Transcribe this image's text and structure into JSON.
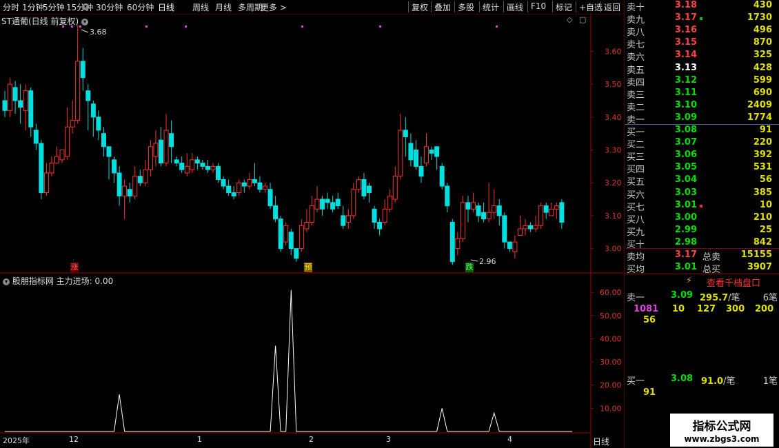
{
  "toolbar": {
    "periods": [
      "分时",
      "1分钟",
      "5分钟",
      "15分钟",
      "30分钟",
      "60分钟",
      "日线",
      "周线",
      "月线",
      "多周期",
      "更多 >"
    ],
    "active_period": "日线",
    "actions": [
      "复权",
      "叠加",
      "多股",
      "统计",
      "画线",
      "F10",
      "标记",
      "+自选",
      "返回"
    ]
  },
  "chart_header": {
    "title": "ST通葡(日线 前复权)",
    "high_label": "3.68",
    "low_label": "2.96"
  },
  "price_axis": {
    "ticks": [
      "3.60",
      "3.50",
      "3.40",
      "3.30",
      "3.20",
      "3.10",
      "3.00"
    ]
  },
  "indicator": {
    "name": "股朋指标网",
    "label": "主力进场: 0.00",
    "ticks": [
      "60.00",
      "50.00",
      "40.00",
      "30.00",
      "20.00",
      "10.00"
    ]
  },
  "badges": {
    "rise": "涨",
    "warn": "预",
    "fall": "跌"
  },
  "date_axis": {
    "labels": [
      "2025年",
      "12",
      "1",
      "2",
      "3",
      "4"
    ],
    "period": "日线"
  },
  "order_book": {
    "asks": [
      {
        "label": "卖十",
        "price": "3.18",
        "vol": "430",
        "color": "red"
      },
      {
        "label": "卖九",
        "price": "3.17",
        "vol": "1730",
        "color": "red",
        "mark": "green"
      },
      {
        "label": "卖八",
        "price": "3.16",
        "vol": "496",
        "color": "red"
      },
      {
        "label": "卖七",
        "price": "3.15",
        "vol": "870",
        "color": "red"
      },
      {
        "label": "卖六",
        "price": "3.14",
        "vol": "325",
        "color": "red"
      },
      {
        "label": "卖五",
        "price": "3.13",
        "vol": "428",
        "color": "white"
      },
      {
        "label": "卖四",
        "price": "3.12",
        "vol": "599",
        "color": "green"
      },
      {
        "label": "卖三",
        "price": "3.11",
        "vol": "690",
        "color": "green"
      },
      {
        "label": "卖二",
        "price": "3.10",
        "vol": "2409",
        "color": "green"
      },
      {
        "label": "卖一",
        "price": "3.09",
        "vol": "1774",
        "color": "green"
      }
    ],
    "bids": [
      {
        "label": "买一",
        "price": "3.08",
        "vol": "91",
        "color": "green"
      },
      {
        "label": "买二",
        "price": "3.07",
        "vol": "220",
        "color": "green"
      },
      {
        "label": "买三",
        "price": "3.06",
        "vol": "392",
        "color": "green"
      },
      {
        "label": "买四",
        "price": "3.05",
        "vol": "531",
        "color": "green"
      },
      {
        "label": "买五",
        "price": "3.04",
        "vol": "56",
        "color": "green"
      },
      {
        "label": "买六",
        "price": "3.03",
        "vol": "385",
        "color": "green"
      },
      {
        "label": "买七",
        "price": "3.01",
        "vol": "10",
        "color": "green",
        "mark": "red"
      },
      {
        "label": "买八",
        "price": "3.00",
        "vol": "210",
        "color": "green"
      },
      {
        "label": "买九",
        "price": "2.99",
        "vol": "25",
        "color": "green"
      },
      {
        "label": "买十",
        "price": "2.98",
        "vol": "842",
        "color": "green"
      }
    ],
    "avg_sell": {
      "label": "卖均",
      "price": "3.17",
      "total_label": "总卖",
      "total": "15155"
    },
    "avg_buy": {
      "label": "买均",
      "price": "3.01",
      "total_label": "总买",
      "total": "3907"
    }
  },
  "depth": {
    "button": "查看千档盘口",
    "sell1": {
      "label": "卖一",
      "price": "3.09",
      "avg": "295.7",
      "unit": "/笔",
      "count": "6笔"
    },
    "sell1_orders": [
      "1081",
      "10",
      "127",
      "300",
      "200"
    ],
    "sell1_orders2": [
      "56"
    ],
    "buy1": {
      "label": "买一",
      "price": "3.08",
      "avg": "91.0",
      "unit": "/笔",
      "count": "1笔"
    },
    "buy1_orders": [
      "91"
    ]
  },
  "watermark": {
    "line1": "指标公式网",
    "line2": "www.zbgs3.com"
  },
  "chart_data": {
    "type": "candlestick",
    "y_range": [
      2.93,
      3.71
    ],
    "indicator_range": [
      0,
      66
    ],
    "candles": [
      [
        3.45,
        3.42,
        3.48,
        3.4
      ],
      [
        3.42,
        3.5,
        3.52,
        3.4
      ],
      [
        3.49,
        3.45,
        3.51,
        3.41
      ],
      [
        3.45,
        3.43,
        3.5,
        3.38
      ],
      [
        3.42,
        3.48,
        3.5,
        3.36
      ],
      [
        3.48,
        3.37,
        3.49,
        3.34
      ],
      [
        3.36,
        3.32,
        3.38,
        3.3
      ],
      [
        3.32,
        3.17,
        3.33,
        3.15
      ],
      [
        3.17,
        3.23,
        3.26,
        3.16
      ],
      [
        3.23,
        3.26,
        3.28,
        3.22
      ],
      [
        3.26,
        3.28,
        3.31,
        3.26
      ],
      [
        3.27,
        3.3,
        3.3,
        3.26
      ],
      [
        3.28,
        3.37,
        3.43,
        3.27
      ],
      [
        3.37,
        3.39,
        3.45,
        3.35
      ],
      [
        3.39,
        3.57,
        3.68,
        3.38
      ],
      [
        3.57,
        3.52,
        3.61,
        3.48
      ],
      [
        3.48,
        3.45,
        3.5,
        3.36
      ],
      [
        3.44,
        3.4,
        3.45,
        3.34
      ],
      [
        3.4,
        3.36,
        3.42,
        3.33
      ],
      [
        3.35,
        3.31,
        3.37,
        3.28
      ],
      [
        3.31,
        3.28,
        3.31,
        3.21
      ],
      [
        3.27,
        3.23,
        3.28,
        3.2
      ],
      [
        3.23,
        3.16,
        3.25,
        3.13
      ],
      [
        3.16,
        3.19,
        3.21,
        3.09
      ],
      [
        3.18,
        3.16,
        3.2,
        3.14
      ],
      [
        3.16,
        3.22,
        3.25,
        3.15
      ],
      [
        3.22,
        3.2,
        3.24,
        3.19
      ],
      [
        3.2,
        3.24,
        3.27,
        3.19
      ],
      [
        3.24,
        3.31,
        3.33,
        3.22
      ],
      [
        3.28,
        3.32,
        3.36,
        3.25
      ],
      [
        3.33,
        3.26,
        3.37,
        3.25
      ],
      [
        3.26,
        3.36,
        3.41,
        3.25
      ],
      [
        3.35,
        3.31,
        3.39,
        3.26
      ],
      [
        3.27,
        3.26,
        3.28,
        3.25
      ],
      [
        3.26,
        3.24,
        3.28,
        3.23
      ],
      [
        3.23,
        3.25,
        3.29,
        3.22
      ],
      [
        3.24,
        3.27,
        3.29,
        3.23
      ],
      [
        3.27,
        3.26,
        3.28,
        3.24
      ],
      [
        3.26,
        3.25,
        3.27,
        3.24
      ],
      [
        3.25,
        3.24,
        3.27,
        3.23
      ],
      [
        3.24,
        3.25,
        3.26,
        3.23
      ],
      [
        3.25,
        3.21,
        3.26,
        3.2
      ],
      [
        3.21,
        3.19,
        3.22,
        3.18
      ],
      [
        3.19,
        3.17,
        3.21,
        3.16
      ],
      [
        3.17,
        3.16,
        3.19,
        3.15
      ],
      [
        3.17,
        3.2,
        3.21,
        3.16
      ],
      [
        3.2,
        3.19,
        3.21,
        3.17
      ],
      [
        3.19,
        3.21,
        3.23,
        3.18
      ],
      [
        3.21,
        3.2,
        3.26,
        3.19
      ],
      [
        3.2,
        3.18,
        3.22,
        3.17
      ],
      [
        3.18,
        3.19,
        3.2,
        3.17
      ],
      [
        3.18,
        3.13,
        3.2,
        3.12
      ],
      [
        3.13,
        3.09,
        3.16,
        3.08
      ],
      [
        3.09,
        3.0,
        3.1,
        2.99
      ],
      [
        3.02,
        3.07,
        3.08,
        3.01
      ],
      [
        3.05,
        3.0,
        3.06,
        2.98
      ],
      [
        3.0,
        2.97,
        3.0,
        2.96
      ],
      [
        3.0,
        3.07,
        3.09,
        2.99
      ],
      [
        3.06,
        3.08,
        3.12,
        3.05
      ],
      [
        3.08,
        3.13,
        3.16,
        3.07
      ],
      [
        3.12,
        3.15,
        3.19,
        3.11
      ],
      [
        3.15,
        3.12,
        3.16,
        3.1
      ],
      [
        3.15,
        3.14,
        3.17,
        3.12
      ],
      [
        3.14,
        3.12,
        3.16,
        3.11
      ],
      [
        3.15,
        3.13,
        3.17,
        3.12
      ],
      [
        3.1,
        3.07,
        3.13,
        3.06
      ],
      [
        3.08,
        3.1,
        3.12,
        3.06
      ],
      [
        3.1,
        3.18,
        3.2,
        3.09
      ],
      [
        3.18,
        3.21,
        3.22,
        3.17
      ],
      [
        3.21,
        3.16,
        3.23,
        3.15
      ],
      [
        3.19,
        3.17,
        3.2,
        3.14
      ],
      [
        3.12,
        3.08,
        3.13,
        3.06
      ],
      [
        3.08,
        3.06,
        3.09,
        3.04
      ],
      [
        3.08,
        3.12,
        3.15,
        3.07
      ],
      [
        3.12,
        3.16,
        3.18,
        3.11
      ],
      [
        3.15,
        3.22,
        3.25,
        3.14
      ],
      [
        3.22,
        3.36,
        3.41,
        3.21
      ],
      [
        3.36,
        3.34,
        3.4,
        3.28
      ],
      [
        3.32,
        3.27,
        3.35,
        3.25
      ],
      [
        3.3,
        3.25,
        3.33,
        3.24
      ],
      [
        3.25,
        3.22,
        3.28,
        3.2
      ],
      [
        3.26,
        3.31,
        3.35,
        3.25
      ],
      [
        3.3,
        3.29,
        3.31,
        3.27
      ],
      [
        3.31,
        3.28,
        3.31,
        3.24
      ],
      [
        3.25,
        3.19,
        3.26,
        3.18
      ],
      [
        3.19,
        3.13,
        3.2,
        3.11
      ],
      [
        3.08,
        2.96,
        3.09,
        2.95
      ],
      [
        3.0,
        3.03,
        3.05,
        2.98
      ],
      [
        3.03,
        3.14,
        3.16,
        3.02
      ],
      [
        3.14,
        3.12,
        3.16,
        3.08
      ],
      [
        3.12,
        3.14,
        3.17,
        3.11
      ],
      [
        3.13,
        3.1,
        3.14,
        3.08
      ],
      [
        3.11,
        3.09,
        3.14,
        3.08
      ],
      [
        3.09,
        3.11,
        3.2,
        3.08
      ],
      [
        3.11,
        3.13,
        3.18,
        3.09
      ],
      [
        3.13,
        3.1,
        3.15,
        3.07
      ],
      [
        3.1,
        3.02,
        3.11,
        3.0
      ],
      [
        3.02,
        3.0,
        3.02,
        2.99
      ],
      [
        2.99,
        3.02,
        3.04,
        2.97
      ],
      [
        3.04,
        3.06,
        3.1,
        3.04
      ],
      [
        3.06,
        3.07,
        3.09,
        3.04
      ],
      [
        3.07,
        3.06,
        3.08,
        3.05
      ],
      [
        3.06,
        3.07,
        3.1,
        3.05
      ],
      [
        3.07,
        3.13,
        3.14,
        3.06
      ],
      [
        3.13,
        3.11,
        3.14,
        3.09
      ],
      [
        3.1,
        3.12,
        3.14,
        3.1
      ],
      [
        3.12,
        3.13,
        3.14,
        3.09
      ],
      [
        3.14,
        3.08,
        3.15,
        3.06
      ]
    ],
    "indicator_values": [
      0,
      0,
      0,
      0,
      0,
      0,
      0,
      0,
      0,
      0,
      0,
      0,
      0,
      0,
      0,
      0,
      0,
      0,
      0,
      0,
      0,
      0,
      16,
      0,
      0,
      0,
      0,
      0,
      0,
      0,
      0,
      0,
      0,
      0,
      0,
      0,
      0,
      0,
      0,
      0,
      0,
      0,
      0,
      0,
      0,
      0,
      0,
      0,
      0,
      0,
      0,
      0,
      37,
      0,
      0,
      61,
      0,
      0,
      0,
      0,
      0,
      0,
      0,
      0,
      0,
      0,
      0,
      0,
      0,
      0,
      0,
      0,
      0,
      0,
      0,
      0,
      0,
      0,
      0,
      0,
      0,
      0,
      0,
      0,
      10,
      0,
      0,
      0,
      0,
      0,
      0,
      0,
      0,
      0,
      8,
      0,
      0,
      0,
      0,
      0,
      0,
      0,
      0,
      0,
      0,
      0,
      0,
      0,
      0,
      0
    ]
  }
}
